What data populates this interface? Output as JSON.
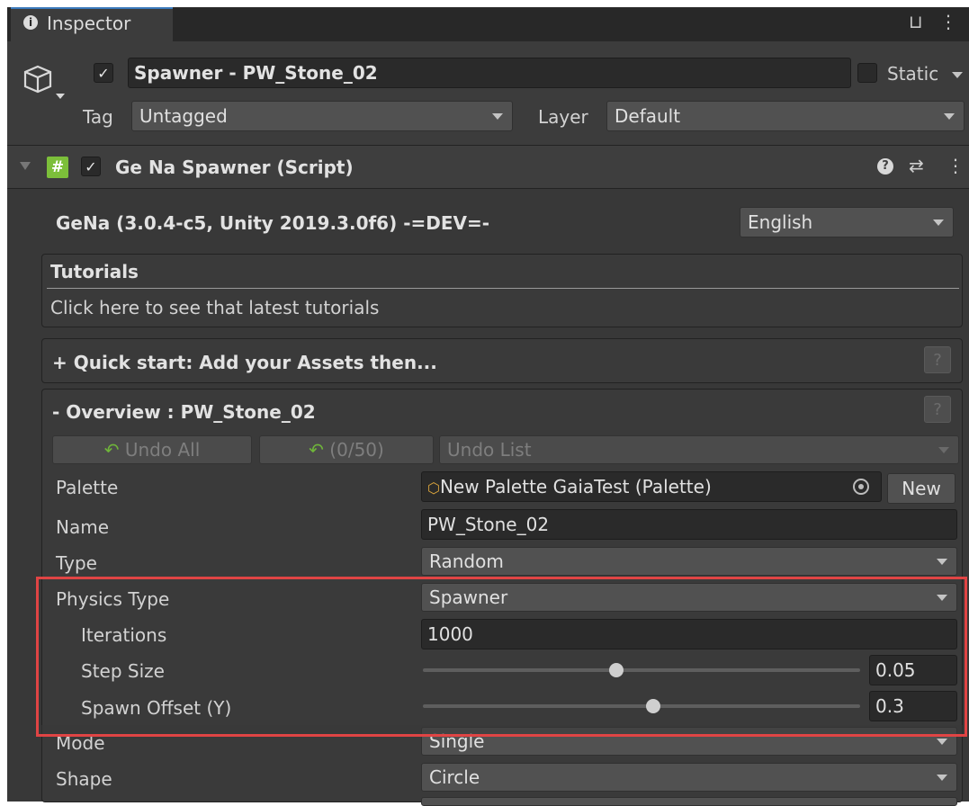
{
  "tab": {
    "label": "Inspector",
    "info_icon": "i"
  },
  "window_icons": "⊔ ⋮",
  "object": {
    "name": "Spawner - PW_Stone_02",
    "active": true,
    "static_label": "Static",
    "tag_label": "Tag",
    "tag_value": "Untagged",
    "layer_label": "Layer",
    "layer_value": "Default"
  },
  "component": {
    "title": "Ge Na Spawner (Script)",
    "enabled": true,
    "help_glyph": "?",
    "settings_glyph": "⇄",
    "menu_glyph": "⋮"
  },
  "version": {
    "text": "GeNa (3.0.4-c5, Unity 2019.3.0f6) -=DEV=-",
    "language": "English"
  },
  "tutorials": {
    "title": "Tutorials",
    "link": "Click here to see that latest tutorials"
  },
  "quick_start": {
    "title": "+ Quick start: Add your Assets then...",
    "help": "?"
  },
  "overview": {
    "title": "- Overview : PW_Stone_02",
    "help": "?",
    "undo_all": "Undo All",
    "undo_count": "(0/50)",
    "undo_list": "Undo List"
  },
  "fields": {
    "palette_label": "Palette",
    "palette_value": "New Palette GaiaTest (Palette)",
    "palette_new": "New",
    "name_label": "Name",
    "name_value": "PW_Stone_02",
    "type_label": "Type",
    "type_value": "Random",
    "physics_label": "Physics Type",
    "physics_value": "Spawner",
    "iterations_label": "Iterations",
    "iterations_value": "1000",
    "step_label": "Step Size",
    "step_value": "0.05",
    "offset_label": "Spawn Offset (Y)",
    "offset_value": "0.3",
    "mode_label": "Mode",
    "mode_value": "Single",
    "shape_label": "Shape",
    "shape_value": "Circle"
  },
  "colors": {
    "highlight": "#e04444",
    "panel": "#383838",
    "accent_tab": "#3a79bb"
  }
}
